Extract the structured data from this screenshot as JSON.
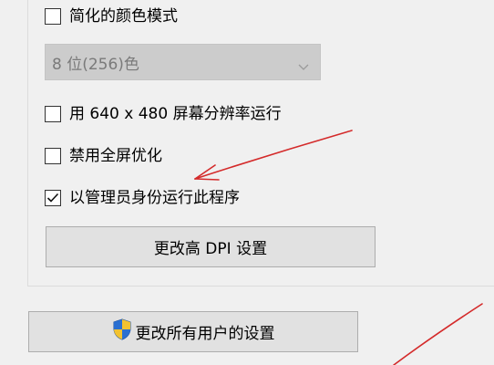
{
  "options": {
    "reduced_color": {
      "label": "简化的颜色模式",
      "checked": false
    },
    "color_depth": {
      "value": "8 位(256)色",
      "enabled": false
    },
    "resolution_640": {
      "label": "用 640 x 480 屏幕分辨率运行",
      "checked": false
    },
    "disable_fullscreen_opt": {
      "label": "禁用全屏优化",
      "checked": false
    },
    "run_as_admin": {
      "label": "以管理员身份运行此程序",
      "checked": true
    }
  },
  "buttons": {
    "change_dpi": "更改高 DPI 设置",
    "change_all_users": "更改所有用户的设置"
  },
  "colors": {
    "annotation_arrow": "#d42a2a",
    "shield_blue": "#2a6fd1",
    "shield_yellow": "#f2c230"
  },
  "icons": [
    "chevron-down-icon",
    "checkmark-icon",
    "uac-shield-icon",
    "arrow-annotation-icon"
  ]
}
